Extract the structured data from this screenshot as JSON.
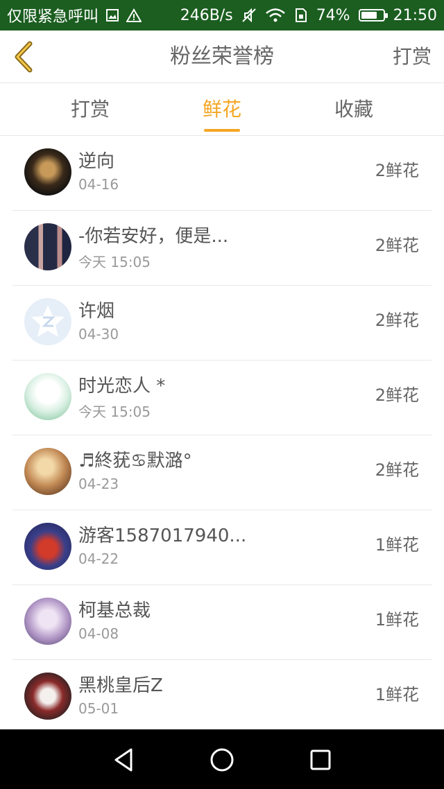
{
  "status_bar": {
    "carrier": "仅限紧急呼叫",
    "speed": "246B/s",
    "battery": "74%",
    "battery_level": 0.74,
    "time": "21:50"
  },
  "header": {
    "title": "粉丝荣誉榜",
    "action_label": "打赏"
  },
  "tabs": [
    {
      "label": "打赏",
      "active": false
    },
    {
      "label": "鲜花",
      "active": true
    },
    {
      "label": "收藏",
      "active": false
    }
  ],
  "fans": [
    {
      "name": "逆向",
      "date": "04-16",
      "count": "2鲜花"
    },
    {
      "name": "-你若安好，便是...",
      "date": "今天 15:05",
      "count": "2鲜花"
    },
    {
      "name": "许烟",
      "date": "04-30",
      "count": "2鲜花"
    },
    {
      "name": "时光恋人 *",
      "date": "今天 15:05",
      "count": "2鲜花"
    },
    {
      "name": "♬終莸♋默潞°",
      "date": "04-23",
      "count": "2鲜花"
    },
    {
      "name": "游客1587017940...",
      "date": "04-22",
      "count": "1鲜花"
    },
    {
      "name": "柯基总裁",
      "date": "04-08",
      "count": "1鲜花"
    },
    {
      "name": "黑桃皇后Z",
      "date": "05-01",
      "count": "1鲜花"
    }
  ],
  "colors": {
    "accent": "#f5a623",
    "status_bar": "#1b5e20",
    "nav_bar": "#000000"
  },
  "icons": {
    "back": "chevron-left-icon",
    "nav_back": "triangle-back-icon",
    "nav_home": "circle-home-icon",
    "nav_recent": "square-recent-icon"
  }
}
